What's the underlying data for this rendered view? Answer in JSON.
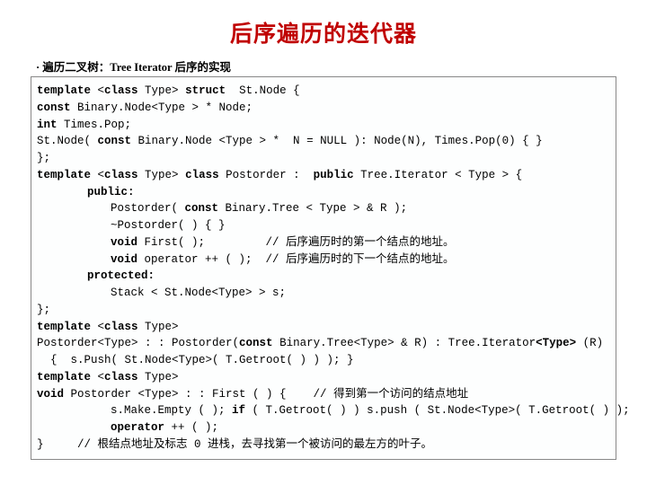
{
  "title": "后序遍历的迭代器",
  "subtitle": "· 遍历二叉树：Tree Iterator   后序的实现",
  "code": {
    "l01a": "template",
    "l01b": " <",
    "l01c": "class",
    "l01d": " Type> ",
    "l01e": "struct",
    "l01f": "  St.Node {",
    "l02a": "const",
    "l02b": " Binary.Node<Type > * Node;",
    "l03a": "int",
    "l03b": " Times.Pop;",
    "l04a": "St.Node( ",
    "l04b": "const",
    "l04c": " Binary.Node <Type > *  N = NULL ): Node(N), Times.Pop(0) { }",
    "l05": "};",
    "l06a": "template",
    "l06b": " <",
    "l06c": "class",
    "l06d": " Type> ",
    "l06e": "class",
    "l06f": " Postorder :  ",
    "l06g": "public",
    "l06h": " Tree.Iterator < Type > {",
    "l07": "public:",
    "l08a": "Postorder( ",
    "l08b": "const",
    "l08c": " Binary.Tree < Type > & R );",
    "l09": "~Postorder( ) { }",
    "l10a": "void",
    "l10b": " First( );         // 后序遍历时的第一个结点的地址。",
    "l11a": "void",
    "l11b": " operator ++ ( );  // 后序遍历时的下一个结点的地址。",
    "l12": "protected:",
    "l13": "Stack < St.Node<Type> > s;",
    "l14": "};",
    "l15a": "template",
    "l15b": " <",
    "l15c": "class",
    "l15d": " Type>",
    "l16a": "Postorder<Type> : : Postorder(",
    "l16b": "const",
    "l16c": " Binary.Tree<Type> & R) : Tree.Iterator",
    "l16d": "<Type>",
    "l16e": " (R)",
    "l17": "  {  s.Push( St.Node<Type>( T.Getroot( ) ) ); }",
    "l18a": "template",
    "l18b": " <",
    "l18c": "class",
    "l18d": " Type>",
    "l19a": "void",
    "l19b": " Postorder <Type> : : First ( ) {    // 得到第一个访问的结点地址",
    "l20a": "s.Make.Empty ( ); ",
    "l20b": "if",
    "l20c": " ( T.Getroot( ) ) s.push ( St.Node<Type>( T.Getroot( ) );",
    "l21a": "operator",
    "l21b": " ++ ( );",
    "l22": "}     // 根结点地址及标志 0 进栈，去寻找第一个被访问的最左方的叶子。"
  }
}
